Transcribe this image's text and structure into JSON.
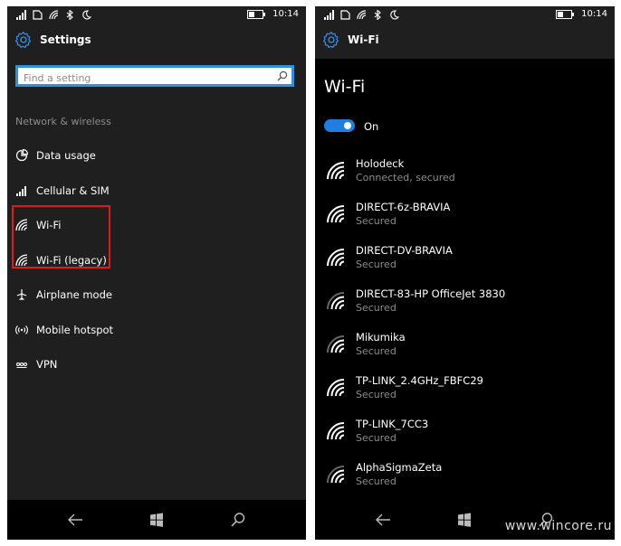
{
  "status_bar": {
    "time": "10:14"
  },
  "left_panel": {
    "title": "Settings",
    "search": {
      "placeholder": "Find a setting"
    },
    "section": "Network & wireless",
    "items": [
      {
        "label": "Data usage",
        "icon": "data-usage-icon"
      },
      {
        "label": "Cellular & SIM",
        "icon": "cellular-signal-icon"
      },
      {
        "label": "Wi-Fi",
        "icon": "wifi-icon"
      },
      {
        "label": "Wi-Fi (legacy)",
        "icon": "wifi-icon"
      },
      {
        "label": "Airplane mode",
        "icon": "airplane-icon"
      },
      {
        "label": "Mobile hotspot",
        "icon": "hotspot-icon"
      },
      {
        "label": "VPN",
        "icon": "vpn-icon"
      }
    ]
  },
  "right_panel": {
    "appbar_title": "Wi-Fi",
    "page_title": "Wi-Fi",
    "toggle": {
      "label": "On",
      "state": true
    },
    "networks": [
      {
        "name": "Holodeck",
        "status": "Connected, secured"
      },
      {
        "name": "DIRECT-6z-BRAVIA",
        "status": "Secured"
      },
      {
        "name": "DIRECT-DV-BRAVIA",
        "status": "Secured"
      },
      {
        "name": "DIRECT-83-HP OfficeJet 3830",
        "status": "Secured"
      },
      {
        "name": "Mikumika",
        "status": "Secured"
      },
      {
        "name": "TP-LINK_2.4GHz_FBFC29",
        "status": "Secured"
      },
      {
        "name": "TP-LINK_7CC3",
        "status": "Secured"
      },
      {
        "name": "AlphaSigmaZeta",
        "status": "Secured"
      }
    ]
  },
  "navigation": {
    "back": "back-arrow-icon",
    "start": "windows-logo-icon",
    "search": "search-icon"
  },
  "watermark": "www.wincore.ru",
  "colors": {
    "accent": "#1e7fe0",
    "highlight": "#e01a1a",
    "background": "#1f1f1f",
    "secondary_text": "#8c8c8c"
  }
}
